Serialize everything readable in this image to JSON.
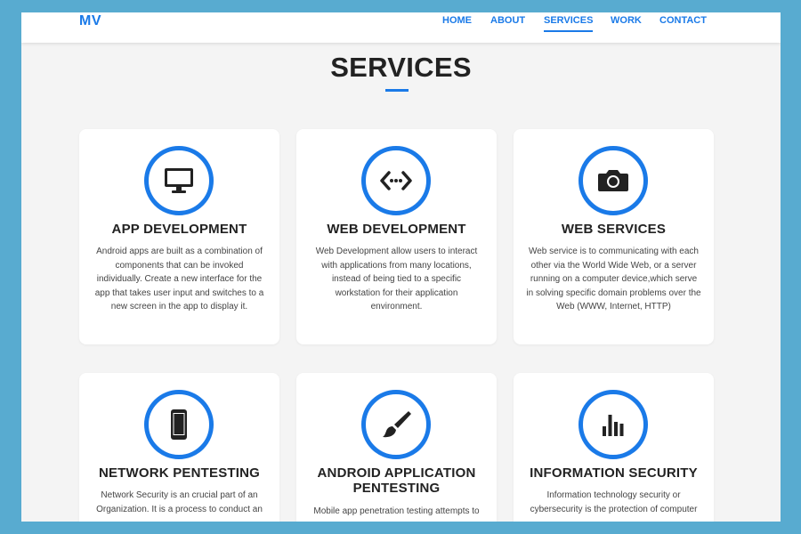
{
  "brand": "MV",
  "nav": {
    "items": [
      {
        "label": "HOME",
        "active": false
      },
      {
        "label": "ABOUT",
        "active": false
      },
      {
        "label": "SERVICES",
        "active": true
      },
      {
        "label": "WORK",
        "active": false
      },
      {
        "label": "CONTACT",
        "active": false
      }
    ]
  },
  "section": {
    "title": "SERVICES"
  },
  "colors": {
    "accent": "#1a7ae8",
    "frame": "#58abd0",
    "page_bg": "#f4f4f4"
  },
  "cards": [
    {
      "icon": "monitor-icon",
      "title": "APP DEVELOPMENT",
      "text": "Android apps are built as a combination of components that can be invoked individually. Create a new interface for the app that takes user input and switches to a new screen in the app to display it."
    },
    {
      "icon": "code-icon",
      "title": "WEB DEVELOPMENT",
      "text": "Web Development allow users to interact with applications from many locations, instead of being tied to a specific workstation for their application environment."
    },
    {
      "icon": "camera-icon",
      "title": "WEB SERVICES",
      "text": "Web service is to communicating with each other via the World Wide Web, or a server running on a computer device,which serve in solving specific domain problems over the Web (WWW, Internet, HTTP)"
    },
    {
      "icon": "mobile-phone-icon",
      "title": "NETWORK PENTESTING",
      "text": "Network Security is an crucial part of an Organization. It is a process to conduct an"
    },
    {
      "icon": "paintbrush-icon",
      "title": "ANDROID APPLICATION PENTESTING",
      "text": "Mobile app penetration testing attempts to"
    },
    {
      "icon": "bar-chart-icon",
      "title": "INFORMATION SECURITY",
      "text": "Information technology security or cybersecurity is the protection of computer"
    }
  ]
}
